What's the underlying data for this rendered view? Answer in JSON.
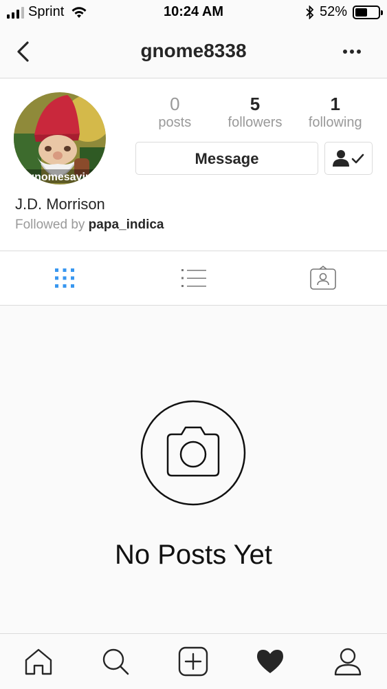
{
  "status_bar": {
    "carrier": "Sprint",
    "time": "10:24 AM",
    "battery": "52%",
    "battery_level": 0.52
  },
  "header": {
    "title": "gnome8338",
    "back_icon": "chevron-left-icon",
    "more_icon": "ellipsis-icon"
  },
  "profile": {
    "avatar_text": "gnomesayin",
    "stats": [
      {
        "value": "0",
        "label": "posts"
      },
      {
        "value": "5",
        "label": "followers"
      },
      {
        "value": "1",
        "label": "following"
      }
    ],
    "message_label": "Message",
    "following_icon": "person-check-icon",
    "display_name": "J.D. Morrison",
    "followed_by_prefix": "Followed by",
    "followed_by_user": "papa_indica"
  },
  "tabs": [
    {
      "icon": "grid-icon",
      "active": true
    },
    {
      "icon": "list-icon",
      "active": false
    },
    {
      "icon": "tagged-icon",
      "active": false
    }
  ],
  "empty_state": {
    "title": "No Posts Yet",
    "icon": "camera-icon"
  },
  "bottom_nav": [
    {
      "icon": "home-icon"
    },
    {
      "icon": "search-icon"
    },
    {
      "icon": "add-post-icon"
    },
    {
      "icon": "heart-icon"
    },
    {
      "icon": "profile-icon"
    }
  ],
  "colors": {
    "accent": "#3897f0",
    "border": "#dbdbdb",
    "muted": "#999999",
    "text": "#262626"
  }
}
